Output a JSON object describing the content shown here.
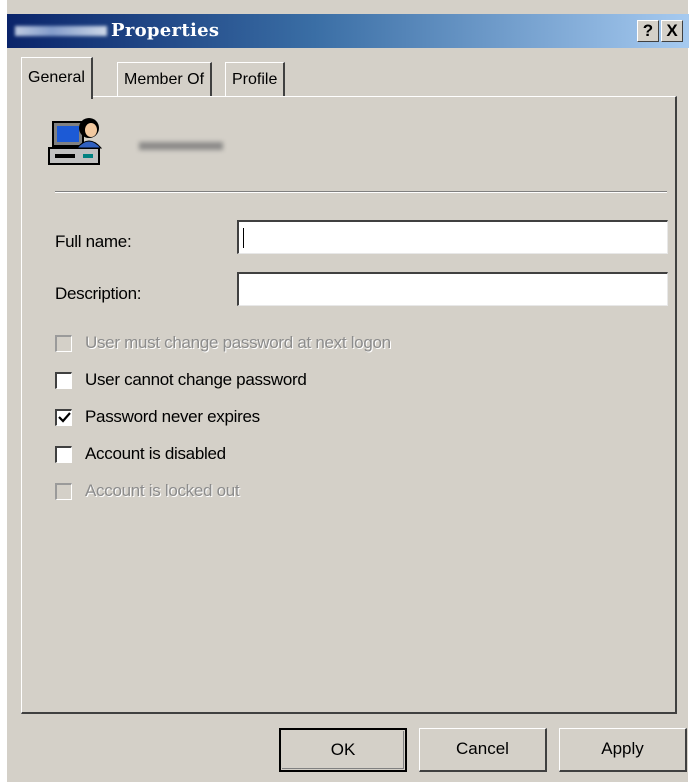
{
  "window": {
    "title": "Properties",
    "help_button": "?",
    "close_button": "X"
  },
  "tabs": [
    {
      "label": "General",
      "active": true
    },
    {
      "label": "Member Of",
      "active": false
    },
    {
      "label": "Profile",
      "active": false
    }
  ],
  "general": {
    "user_icon": "user-computer-icon",
    "full_name_label": "Full name:",
    "full_name_value": "",
    "description_label": "Description:",
    "description_value": "",
    "checkboxes": [
      {
        "label": "User must change password at next logon",
        "checked": false,
        "enabled": false
      },
      {
        "label": "User cannot change password",
        "checked": false,
        "enabled": true
      },
      {
        "label": "Password never expires",
        "checked": true,
        "enabled": true
      },
      {
        "label": "Account is disabled",
        "checked": false,
        "enabled": true
      },
      {
        "label": "Account is locked out",
        "checked": false,
        "enabled": false
      }
    ]
  },
  "buttons": {
    "ok": "OK",
    "cancel": "Cancel",
    "apply": "Apply"
  }
}
